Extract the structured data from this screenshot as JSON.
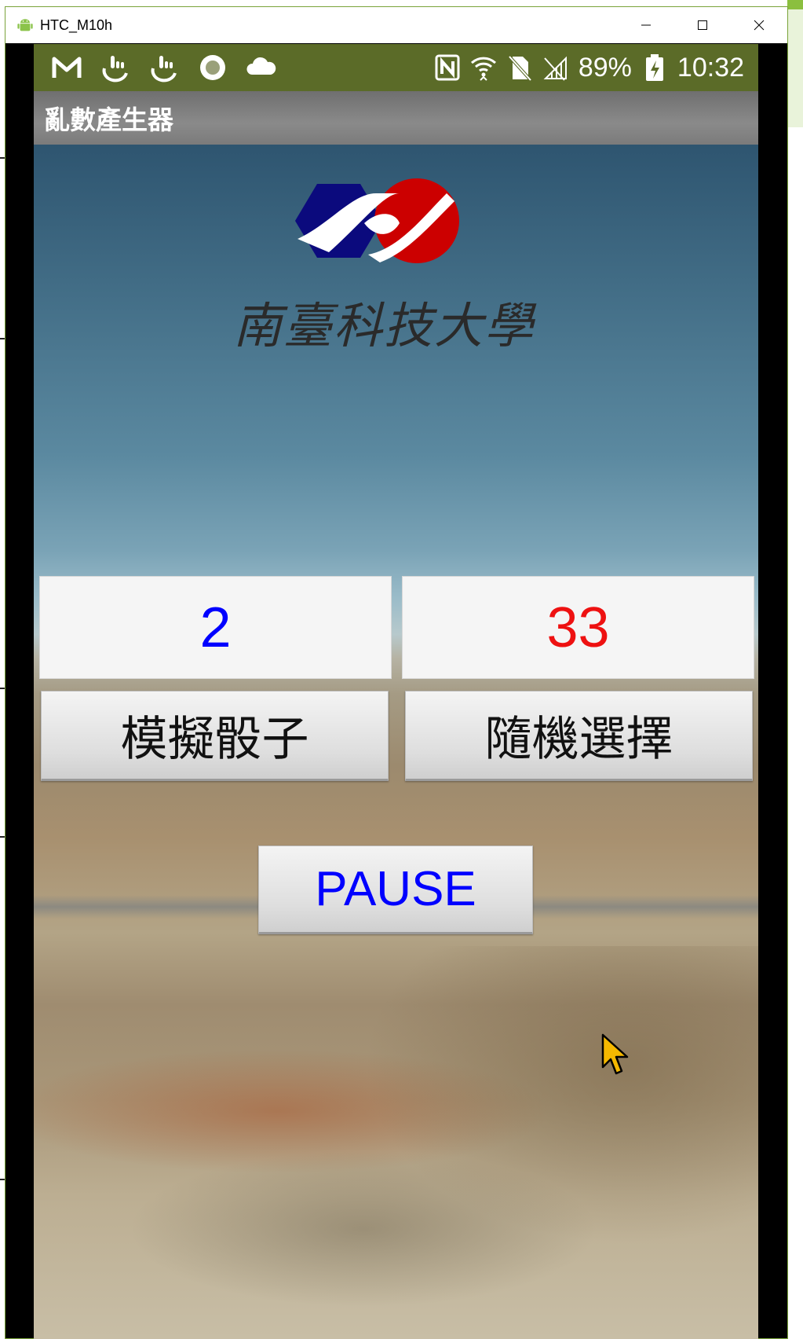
{
  "window": {
    "title": "HTC_M10h"
  },
  "status_bar": {
    "battery": "89%",
    "time": "10:32",
    "left_icons": [
      "gmail-icon",
      "touch-icon",
      "touch-icon",
      "record-icon",
      "cloud-icon"
    ],
    "right_icons": [
      "nfc-icon",
      "wifi-icon",
      "no-sim-icon",
      "signal-icon",
      "battery-charging-icon"
    ],
    "color": "#5b6b28"
  },
  "action_bar": {
    "title": "亂數產生器"
  },
  "logo": {
    "text": "南臺科技大學",
    "colors": {
      "blue": "#0b0a7d",
      "red": "#cc0000"
    }
  },
  "results": {
    "left_value": "2",
    "right_value": "33",
    "left_color": "#0000ff",
    "right_color": "#ee1111"
  },
  "buttons": {
    "dice_label": "模擬骰子",
    "random_label": "隨機選擇",
    "pause_label": "PAUSE"
  }
}
